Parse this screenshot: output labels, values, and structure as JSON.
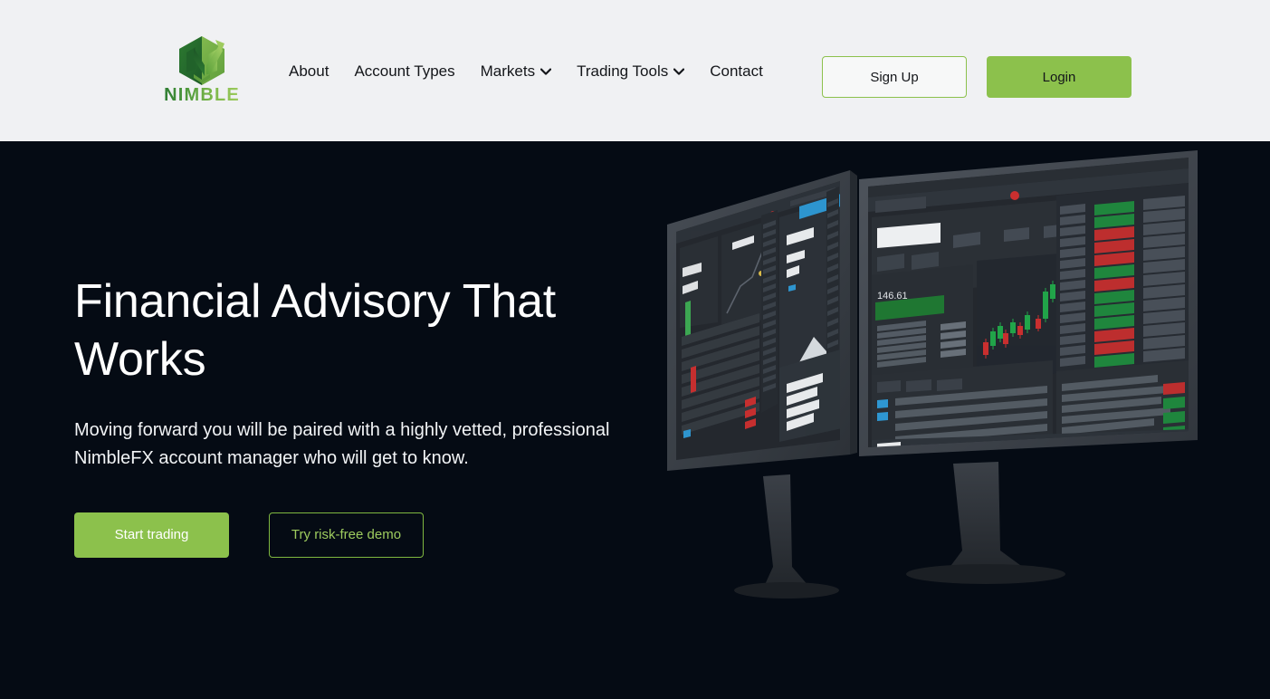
{
  "header": {
    "logo": {
      "icon": "nimble-hexagon-logo-icon",
      "wordmark": "NIMBLE"
    },
    "nav": [
      {
        "label": "About",
        "has_dropdown": false
      },
      {
        "label": "Account Types",
        "has_dropdown": false
      },
      {
        "label": "Markets",
        "has_dropdown": true
      },
      {
        "label": "Trading Tools",
        "has_dropdown": true
      },
      {
        "label": "Contact",
        "has_dropdown": false
      }
    ],
    "signup_label": "Sign Up",
    "login_label": "Login"
  },
  "hero": {
    "title": "Financial Advisory That Works",
    "subtitle": "Moving forward you will be paired with a highly vetted, professional NimbleFX account manager who will get to know.",
    "primary_cta": "Start trading",
    "secondary_cta": "Try risk-free demo",
    "artwork": "dual-trading-monitors-image"
  },
  "colors": {
    "brand_green": "#8cc14c",
    "brand_green_dark": "#2f7d33",
    "header_bg": "#f0f1f3",
    "hero_bg": "#050b14",
    "demo_text": "#9ecb5e",
    "candle_up": "#21a84a",
    "candle_down": "#cf3030",
    "monitor_body": "#3a3f46",
    "monitor_screen": "#2b2f35",
    "accent_blue": "#2f9bd8"
  }
}
